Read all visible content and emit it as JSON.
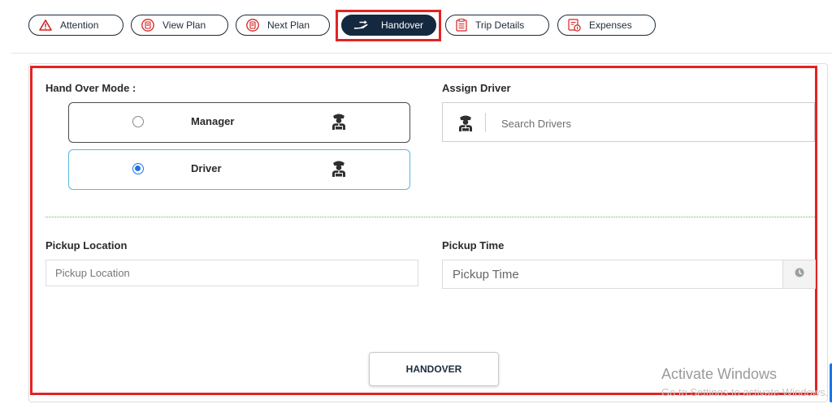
{
  "tabs": [
    {
      "label": "Attention",
      "icon": "warning-triangle-icon"
    },
    {
      "label": "View Plan",
      "icon": "document-icon"
    },
    {
      "label": "Next Plan",
      "icon": "document-icon"
    },
    {
      "label": "Handover",
      "icon": "hand-icon",
      "active": true
    },
    {
      "label": "Trip Details",
      "icon": "list-icon"
    },
    {
      "label": "Expenses",
      "icon": "receipt-icon"
    }
  ],
  "form": {
    "handover_mode_label": "Hand Over Mode :",
    "modes": [
      {
        "label": "Manager",
        "selected": false,
        "icon": "driver-person-icon"
      },
      {
        "label": "Driver",
        "selected": true,
        "icon": "driver-person-icon"
      }
    ],
    "assign_driver_label": "Assign Driver",
    "driver_search_placeholder": "Search Drivers",
    "pickup_location_label": "Pickup Location",
    "pickup_location_placeholder": "Pickup Location",
    "pickup_time_label": "Pickup Time",
    "pickup_time_placeholder": "Pickup Time",
    "submit_label": "HANDOVER"
  },
  "watermark": {
    "line1": "Activate Windows",
    "line2": "Go to Settings to activate Windows."
  },
  "colors": {
    "highlight": "#e32323",
    "active_tab": "#14293f",
    "radio_selected": "#1a73e8",
    "selected_border": "#5bb7de",
    "divider": "#66b566"
  }
}
